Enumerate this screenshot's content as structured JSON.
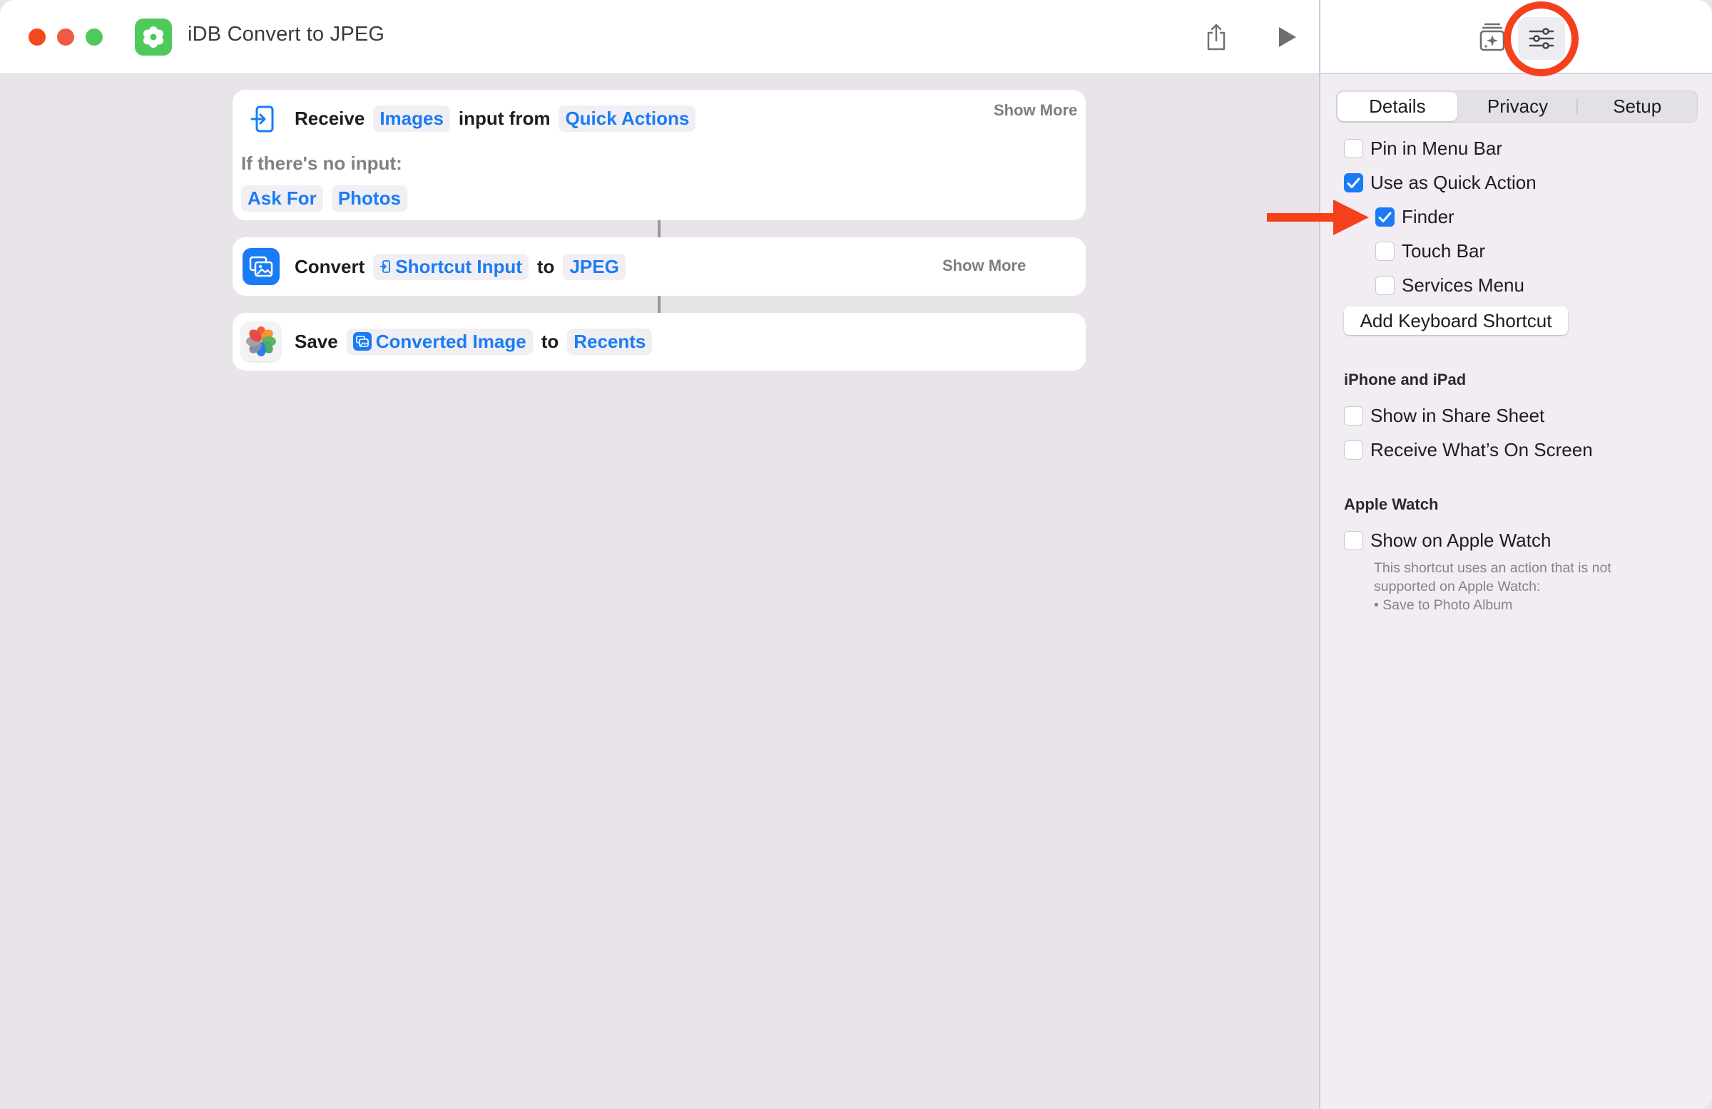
{
  "window": {
    "title": "iDB Convert to JPEG",
    "app_icon": "shortcut-gear-flower-icon",
    "traffic_lights": [
      "close",
      "minimize",
      "zoom"
    ],
    "toolbar": {
      "share_icon": "share-icon",
      "run_icon": "play-icon"
    }
  },
  "actions": [
    {
      "icon": "receive-input-icon",
      "verb": "Receive",
      "type_pill": "Images",
      "middle": "input from",
      "source_pill": "Quick Actions",
      "show_more": "Show More",
      "no_input_label": "If there's no input:",
      "fallback_pills": [
        "Ask For",
        "Photos"
      ]
    },
    {
      "icon": "convert-image-icon",
      "verb": "Convert",
      "input_pill": "Shortcut Input",
      "middle": "to",
      "format_pill": "JPEG",
      "show_more": "Show More"
    },
    {
      "icon": "photos-app-icon",
      "verb": "Save",
      "image_pill": "Converted Image",
      "middle": "to",
      "album_pill": "Recents"
    }
  ],
  "inspector": {
    "toolbar": {
      "gallery_icon": "action-library-icon",
      "settings_icon": "sliders-icon"
    },
    "tabs": [
      {
        "label": "Details",
        "active": true
      },
      {
        "label": "Privacy",
        "active": false
      },
      {
        "label": "Setup",
        "active": false
      }
    ],
    "options": {
      "pin_menu_bar": {
        "label": "Pin in Menu Bar",
        "checked": false
      },
      "quick_action": {
        "label": "Use as Quick Action",
        "checked": true
      },
      "finder": {
        "label": "Finder",
        "checked": true
      },
      "touch_bar": {
        "label": "Touch Bar",
        "checked": false
      },
      "services_menu": {
        "label": "Services Menu",
        "checked": false
      }
    },
    "add_shortcut_label": "Add Keyboard Shortcut",
    "iphone_section": {
      "heading": "iPhone and iPad",
      "share_sheet": {
        "label": "Show in Share Sheet",
        "checked": false
      },
      "on_screen": {
        "label": "Receive What’s On Screen",
        "checked": false
      }
    },
    "watch_section": {
      "heading": "Apple Watch",
      "show_on_watch": {
        "label": "Show on Apple Watch",
        "checked": false
      },
      "note_line1": "This shortcut uses an action that is not",
      "note_line2": "supported on Apple Watch:",
      "note_line3": "• Save to Photo Album"
    }
  },
  "annotations": {
    "highlight_color": "#f4411c",
    "arrow_target": "Finder",
    "circle_target": "settings"
  },
  "colors": {
    "accent": "#1a7cf5",
    "app_green": "#4fc95a"
  }
}
